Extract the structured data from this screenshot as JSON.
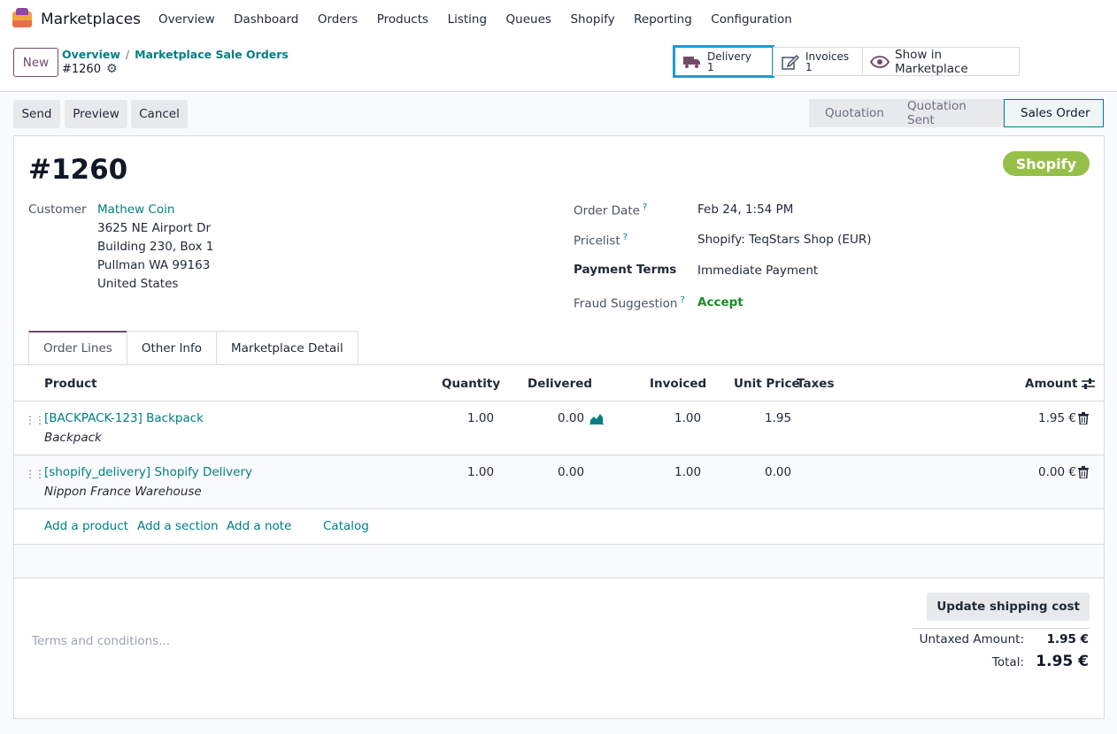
{
  "navbar": {
    "app_name": "Marketplaces",
    "menu": [
      "Overview",
      "Dashboard",
      "Orders",
      "Products",
      "Listing",
      "Queues",
      "Shopify",
      "Reporting",
      "Configuration"
    ]
  },
  "control_panel": {
    "new_label": "New",
    "breadcrumb": {
      "root": "Overview",
      "sep": "/",
      "parent": "Marketplace Sale Orders",
      "current": "#1260"
    },
    "smart_buttons": {
      "delivery": {
        "label": "Delivery",
        "count": "1",
        "icon": "truck-icon"
      },
      "invoices": {
        "label": "Invoices",
        "count": "1",
        "icon": "pencil-square-icon"
      },
      "marketplace": {
        "label": "Show in Marketplace",
        "icon": "eye-icon"
      }
    }
  },
  "actions": {
    "send": "Send",
    "preview": "Preview",
    "cancel": "Cancel"
  },
  "stages": {
    "quotation": "Quotation",
    "quotation_sent": "Quotation Sent",
    "sales_order": "Sales Order"
  },
  "order": {
    "number": "#1260",
    "channel_badge": "Shopify",
    "customer_label": "Customer",
    "customer_name": "Mathew Coin",
    "address": [
      "3625 NE Airport Dr",
      "Building 230, Box 1",
      "Pullman WA 99163",
      "United States"
    ],
    "order_date_label": "Order Date",
    "order_date": "Feb 24, 1:54 PM",
    "pricelist_label": "Pricelist",
    "pricelist": "Shopify: TeqStars Shop (EUR)",
    "payment_terms_label": "Payment Terms",
    "payment_terms": "Immediate Payment",
    "fraud_label": "Fraud Suggestion",
    "fraud_value": "Accept",
    "help_mark": "?"
  },
  "tabs": {
    "order_lines": "Order Lines",
    "other_info": "Other Info",
    "marketplace_detail": "Marketplace Detail"
  },
  "table": {
    "headers": {
      "product": "Product",
      "quantity": "Quantity",
      "delivered": "Delivered",
      "invoiced": "Invoiced",
      "unit_price": "Unit Price",
      "taxes": "Taxes",
      "amount": "Amount"
    },
    "rows": [
      {
        "product": "[BACKPACK-123] Backpack",
        "description": "Backpack",
        "quantity": "1.00",
        "delivered": "0.00",
        "invoiced": "1.00",
        "unit_price": "1.95",
        "amount": "1.95 €"
      },
      {
        "product": "[shopify_delivery] Shopify Delivery",
        "description": "Nippon France Warehouse",
        "quantity": "1.00",
        "delivered": "0.00",
        "invoiced": "1.00",
        "unit_price": "0.00",
        "amount": "0.00 €"
      }
    ],
    "add_links": {
      "product": "Add a product",
      "section": "Add a section",
      "note": "Add a note",
      "catalog": "Catalog"
    }
  },
  "footer": {
    "terms_placeholder": "Terms and conditions...",
    "update_shipping": "Update shipping cost",
    "untaxed_label": "Untaxed Amount:",
    "untaxed_value": "1.95 €",
    "total_label": "Total:",
    "total_value": "1.95 €"
  }
}
